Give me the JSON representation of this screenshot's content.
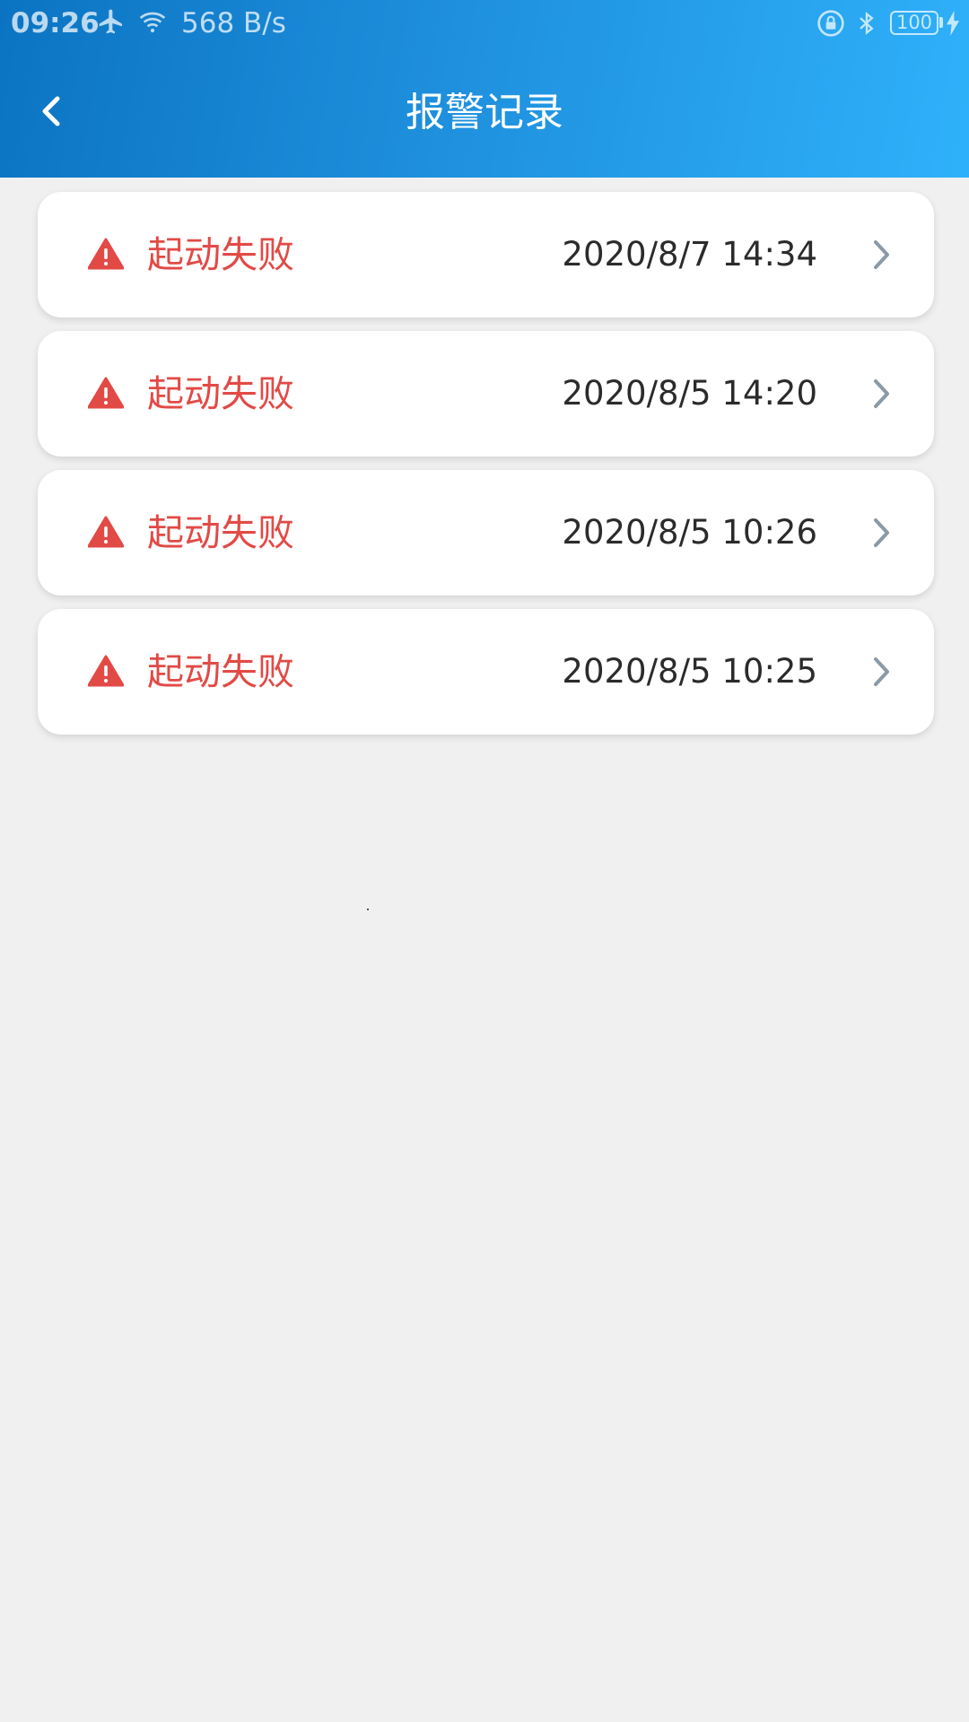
{
  "status_bar": {
    "time": "09:26",
    "net_speed": "568 B/s",
    "battery": "100",
    "icons": [
      "airplane-icon",
      "wifi-icon",
      "lock-rotation-icon",
      "bluetooth-icon",
      "battery-icon",
      "charging-icon"
    ]
  },
  "header": {
    "title": "报警记录",
    "back_icon": "chevron-left-icon"
  },
  "alarms": [
    {
      "label": "起动失败",
      "time": "2020/8/7 14:34"
    },
    {
      "label": "起动失败",
      "time": "2020/8/5 14:20"
    },
    {
      "label": "起动失败",
      "time": "2020/8/5 10:26"
    },
    {
      "label": "起动失败",
      "time": "2020/8/5 10:25"
    }
  ],
  "colors": {
    "header_start": "#0b74c2",
    "header_end": "#2fb1fa",
    "alarm_red": "#e24a46",
    "background": "#f0f0f0",
    "chevron": "#8a9aa6"
  }
}
